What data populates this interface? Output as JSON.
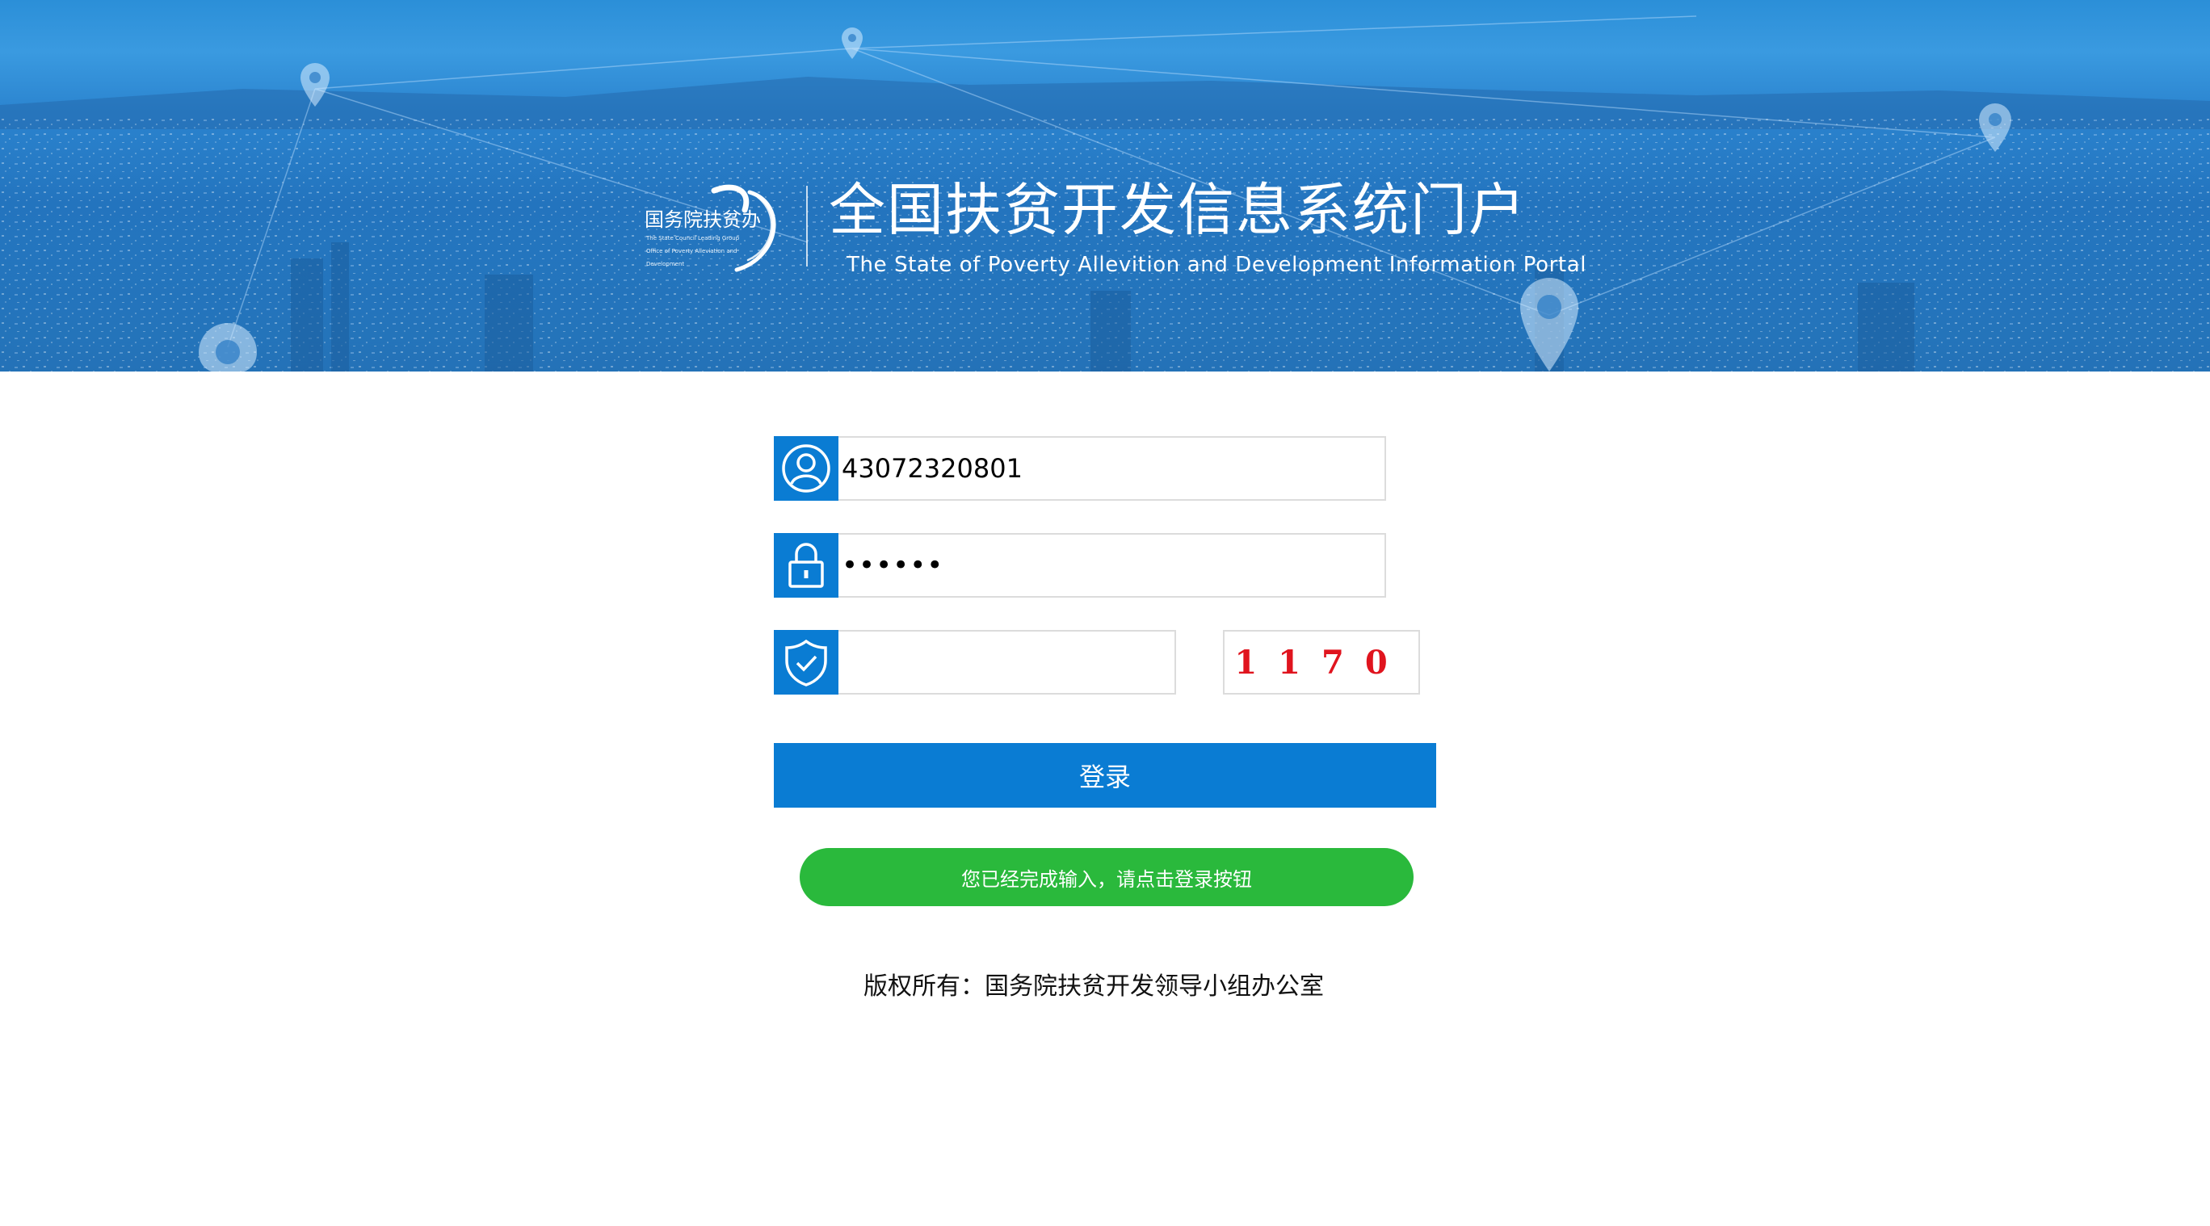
{
  "banner": {
    "logo_text": "国务院扶贫办",
    "logo_subtitle_lines": [
      "The State Council Leading Group",
      "Office of Poverty Alleviation and",
      "Development"
    ],
    "title": "全国扶贫开发信息系统门户",
    "title_en": "The State of Poverty Allevition and Development Information Portal"
  },
  "form": {
    "username_value": "43072320801",
    "password_value": "••••••",
    "verification_value": "",
    "captcha_text": "1170",
    "login_label": "登录"
  },
  "status_message": "您已经完成输入，请点击登录按钮",
  "footer": {
    "copyright": "版权所有：国务院扶贫开发领导小组办公室"
  },
  "icons": {
    "user": "user-icon",
    "lock": "lock-icon",
    "shield": "shield-check-icon"
  },
  "colors": {
    "primary_blue": "#0a7cd3",
    "success_green": "#2ab93c",
    "captcha_red": "#e0141e"
  }
}
